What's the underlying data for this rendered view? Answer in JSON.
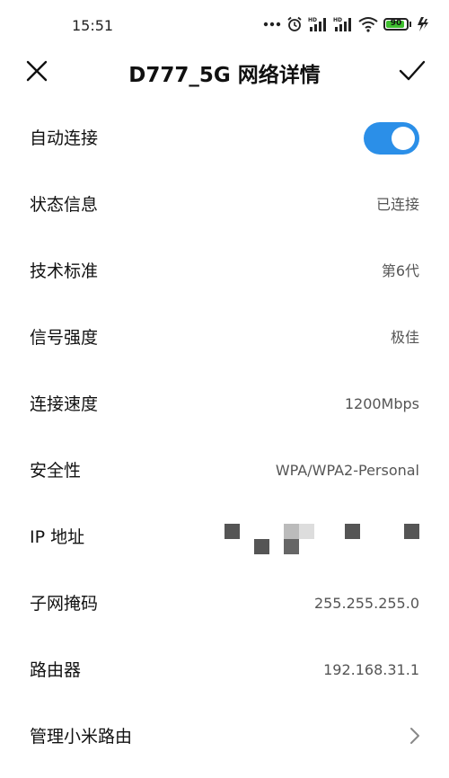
{
  "status_bar": {
    "time": "15:51",
    "battery_level": "90",
    "battery_fraction": 0.9,
    "network_badge": "HD",
    "icons": [
      "more-dots-icon",
      "alarm-icon",
      "signal-hd-icon",
      "signal-hd-icon",
      "wifi-icon",
      "battery-icon",
      "charging-icon"
    ]
  },
  "header": {
    "title": "D777_5G 网络详情",
    "close_icon": "close-icon",
    "confirm_icon": "check-icon"
  },
  "rows": [
    {
      "label": "自动连接",
      "type": "toggle",
      "toggle_on": true,
      "accent_color": "#2b8fe8"
    },
    {
      "label": "状态信息",
      "value": "已连接"
    },
    {
      "label": "技术标准",
      "value": "第6代"
    },
    {
      "label": "信号强度",
      "value": "极佳"
    },
    {
      "label": "连接速度",
      "value": "1200Mbps"
    },
    {
      "label": "安全性",
      "value": "WPA/WPA2-Personal"
    },
    {
      "label": "IP 地址",
      "value_redacted": true
    },
    {
      "label": "子网掩码",
      "value": "255.255.255.0"
    },
    {
      "label": "路由器",
      "value": "192.168.31.1"
    },
    {
      "label": "管理小米路由",
      "type": "link",
      "icon": "chevron-right-icon"
    }
  ]
}
